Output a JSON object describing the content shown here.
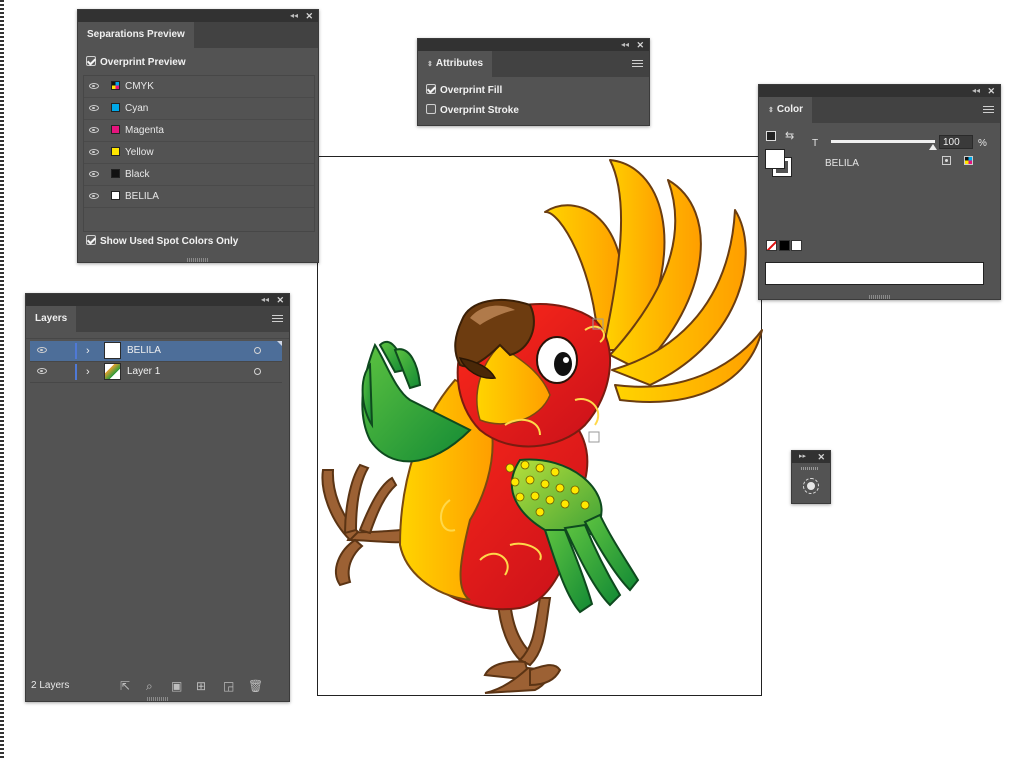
{
  "separations": {
    "tab": "Separations Preview",
    "overprint_preview": {
      "label": "Overprint Preview",
      "checked": true
    },
    "items": [
      {
        "label": "CMYK",
        "swatch": "cmyk"
      },
      {
        "label": "Cyan",
        "swatch": "#00a8e8"
      },
      {
        "label": "Magenta",
        "swatch": "#e5147d"
      },
      {
        "label": "Yellow",
        "swatch": "#ffe600"
      },
      {
        "label": "Black",
        "swatch": "#111111"
      },
      {
        "label": "BELILA",
        "swatch": "#ffffff"
      }
    ],
    "show_used_spot": {
      "label": "Show Used Spot Colors Only",
      "checked": true
    }
  },
  "attributes": {
    "tab": "Attributes",
    "overprint_fill": {
      "label": "Overprint Fill",
      "checked": true
    },
    "overprint_stroke": {
      "label": "Overprint Stroke",
      "checked": false
    }
  },
  "color": {
    "tab": "Color",
    "tint_label": "T",
    "tint_value": "100",
    "percent": "%",
    "swatch_name": "BELILA"
  },
  "layers": {
    "tab": "Layers",
    "items": [
      {
        "name": "BELILA",
        "selected": true
      },
      {
        "name": "Layer 1",
        "selected": false
      }
    ],
    "count": "2 Layers"
  },
  "theme": {
    "panel_bg": "#535353",
    "selection": "#4d6e99",
    "layer_color": "#4f79d6"
  }
}
